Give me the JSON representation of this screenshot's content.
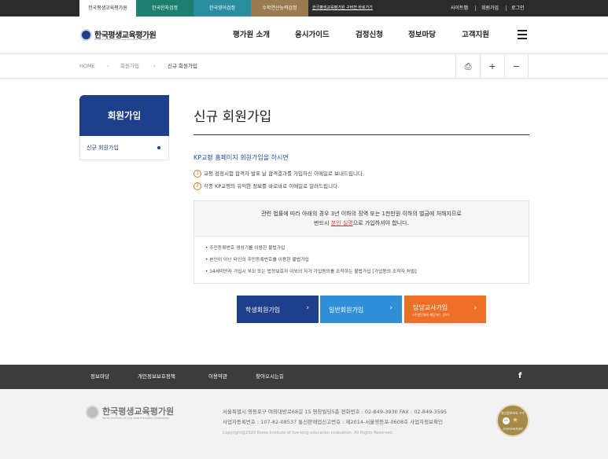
{
  "topbar": {
    "tabs": [
      {
        "label": "한국평생교육평가원",
        "bg": "#ffffff",
        "fg": "#333333"
      },
      {
        "label": "한국한자검정",
        "bg": "#1d7f6f"
      },
      {
        "label": "한국영어검정",
        "bg": "#2a8ea0"
      },
      {
        "label": "수학연산능력검정",
        "bg": "#9a7b50"
      }
    ],
    "notice": "한국평생교육평가원 구버전 바로가기",
    "util": [
      "사이트맵",
      "회원가입",
      "로그인"
    ]
  },
  "header": {
    "logo_name": "한국평생교육평가원",
    "logo_sub": "Korea Institute of Live-long Education Evaluation",
    "menu": [
      "평가원 소개",
      "응시가이드",
      "검정신청",
      "정보마당",
      "고객지원"
    ]
  },
  "breadcrumb": {
    "items": [
      "HOME",
      "회원가입",
      "신규 회원가입"
    ],
    "arrow": "›",
    "tools": {
      "print": "⎙",
      "plus": "+",
      "minus": "−"
    }
  },
  "lnb": {
    "title": "회원가입",
    "items": [
      "신규 회원가입"
    ]
  },
  "content": {
    "title": "신규 회원가입",
    "lead": "KP교평 홈페이지 회원가입을 하시면",
    "points": [
      {
        "num": "1",
        "text": "교평 검정시험 합격자 발표 날 합격결과를 가입하신 이메일로 보내드립니다."
      },
      {
        "num": "2",
        "text": "각종 KP교평의 유익한 정보를 바로바로 이메일로 알려드립니다."
      }
    ],
    "notice": {
      "line1": "관련 법률에 따라 아래의 경우 3년 이하의 징역 또는 1천만원 이하의 벌금에 처해지므로",
      "line2_pre": "반드시",
      "line2_red": "본인 실명",
      "line2_post": "으로 가입하셔야 합니다.",
      "bullets": [
        "주민등록번호 생성기를 이용한 불법가입",
        "본인이 아닌 타인의 주민등록번호를 이용한 불법가입",
        "14세미만자 가입시 부모 또는 법정보호자 이외의 자가 가입동의를 조작하는 불법가입 [가입동의 조작자 처벌]"
      ]
    },
    "buttons": [
      {
        "label": "학생회원가입",
        "sub": "",
        "color": "#1e3f8c"
      },
      {
        "label": "일반회원가입",
        "sub": "",
        "color": "#2f8fd8"
      },
      {
        "label": "담당교사가입",
        "sub": "(주관단체에 해당하는 경우)",
        "color": "#ee7027"
      }
    ],
    "button_arrow": "›"
  },
  "footer": {
    "nav": [
      "정보마당",
      "개인정보보호정책",
      "이용약관",
      "찾아오시는길"
    ],
    "facebook": "f",
    "logo_name": "한국평생교육평가원",
    "logo_sub": "Korea Institute of Live-long Education Evaluation",
    "address": "서울특별시 영등포구 여의대방로68길 15 영창빌딩5층 전화번호 : 02-849-3930 FAX : 02-849-3595",
    "biz": "사업자등록번호 : 107-82-08537 통신판매업신고번호 : 제2014-서울영등포-0608호 사업자정보확인",
    "copyright": "Copyright@2020 Korea Institute of live-long education evaluation. All Rights Reserved.",
    "seal_top": "개인정보보호 우수",
    "seal_mid": "KB",
    "seal_bottom": "사이버소비자센터"
  }
}
